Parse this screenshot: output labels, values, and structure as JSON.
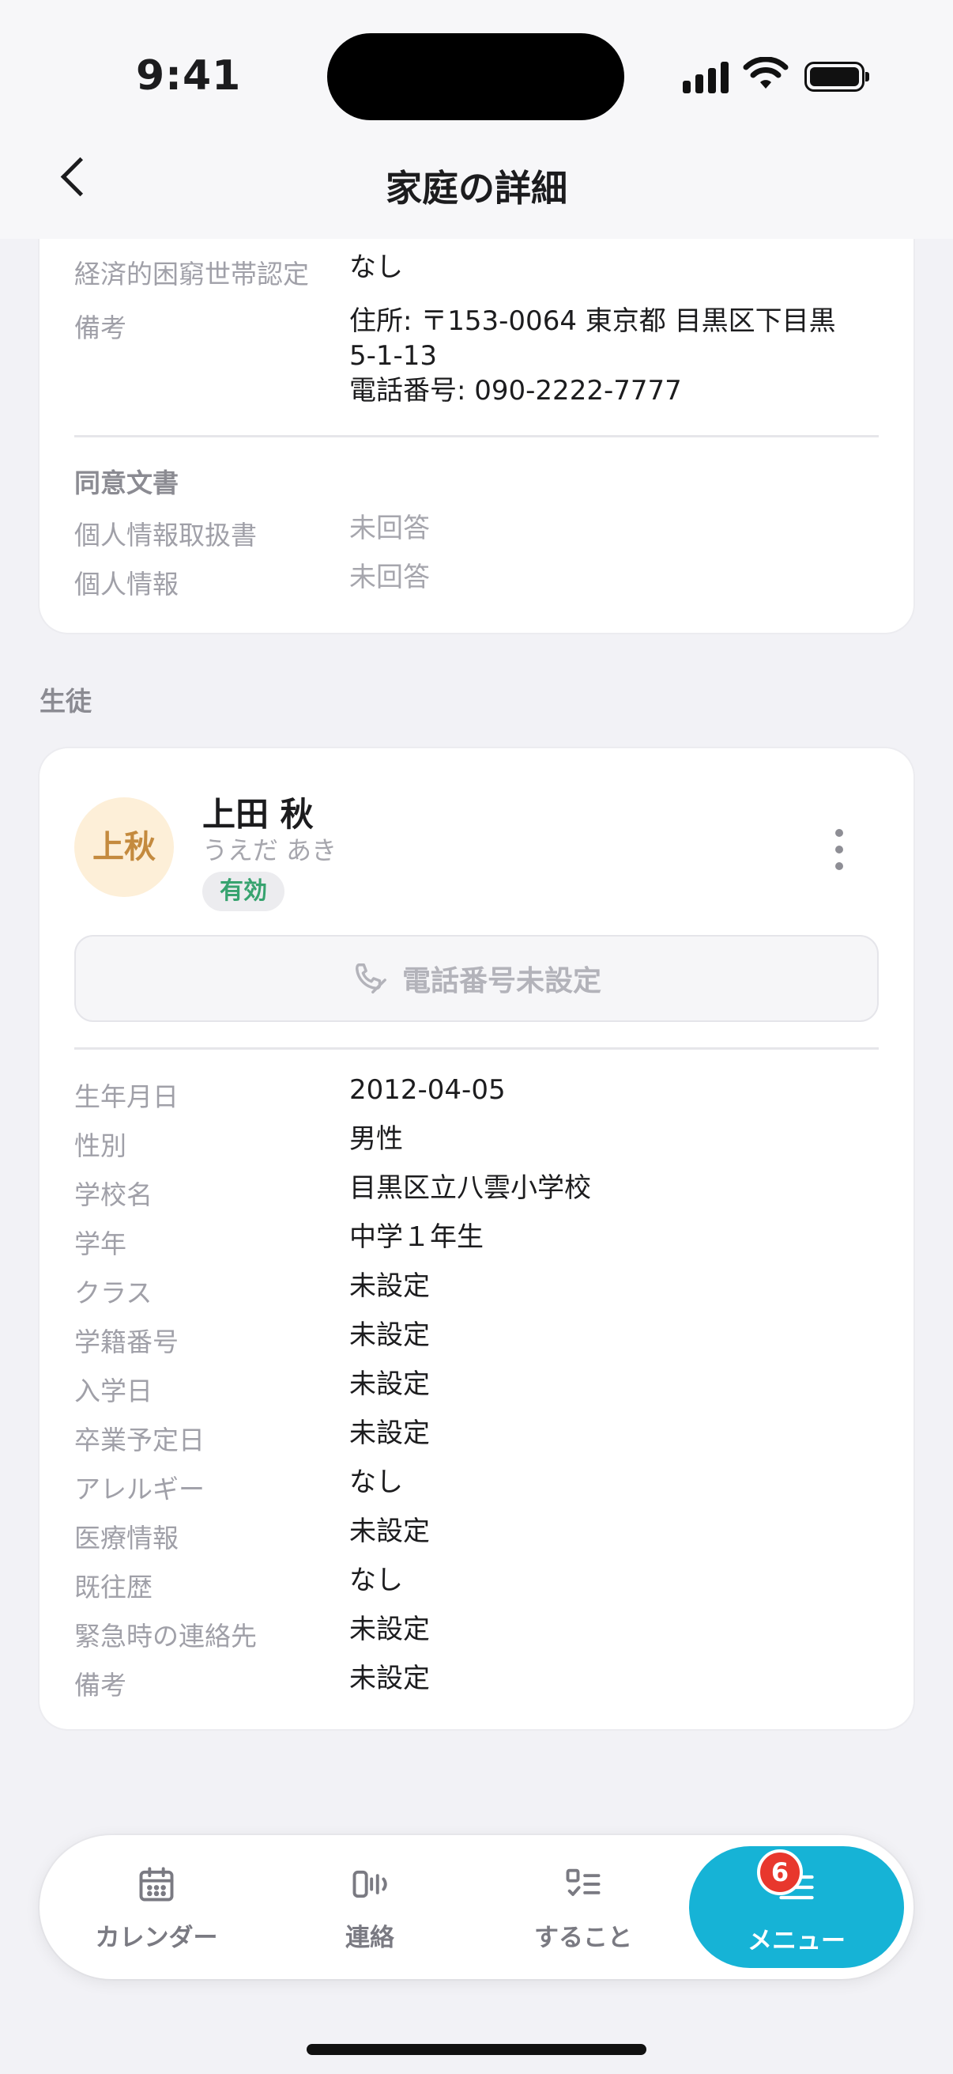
{
  "status": {
    "time": "9:41"
  },
  "header": {
    "title": "家庭の詳細"
  },
  "family": {
    "partial_label": "経済的困窮世帯認定",
    "partial_value": "なし",
    "remarks_label": "備考",
    "remarks_lines": [
      "住所: 〒153-0064 東京都 目黒区下目黒",
      "5-1-13",
      "電話番号: 090-2222-7777"
    ],
    "consent_title": "同意文書",
    "consents": [
      {
        "label": "個人情報取扱書",
        "value": "未回答"
      },
      {
        "label": "個人情報",
        "value": "未回答"
      }
    ]
  },
  "students_section": "生徒",
  "student": {
    "avatar_text": "上秋",
    "name": "上田 秋",
    "kana": "うえだ あき",
    "status": "有効",
    "phone_button": "電話番号未設定",
    "fields": [
      {
        "label": "生年月日",
        "value": "2012-04-05"
      },
      {
        "label": "性別",
        "value": "男性"
      },
      {
        "label": "学校名",
        "value": "目黒区立八雲小学校"
      },
      {
        "label": "学年",
        "value": "中学１年生"
      },
      {
        "label": "クラス",
        "value": "未設定"
      },
      {
        "label": "学籍番号",
        "value": "未設定"
      },
      {
        "label": "入学日",
        "value": "未設定"
      },
      {
        "label": "卒業予定日",
        "value": "未設定"
      },
      {
        "label": "アレルギー",
        "value": "なし"
      },
      {
        "label": "医療情報",
        "value": "未設定"
      },
      {
        "label": "既往歴",
        "value": "なし"
      },
      {
        "label": "緊急時の連絡先",
        "value": "未設定"
      },
      {
        "label": "備考",
        "value": "未設定"
      }
    ]
  },
  "tabbar": {
    "items": [
      {
        "label": "カレンダー",
        "icon": "calendar-icon"
      },
      {
        "label": "連絡",
        "icon": "broadcast-icon"
      },
      {
        "label": "すること",
        "icon": "checklist-icon"
      },
      {
        "label": "メニュー",
        "icon": "menu-icon"
      }
    ],
    "badge": "6",
    "accent": "#16b3d6"
  }
}
